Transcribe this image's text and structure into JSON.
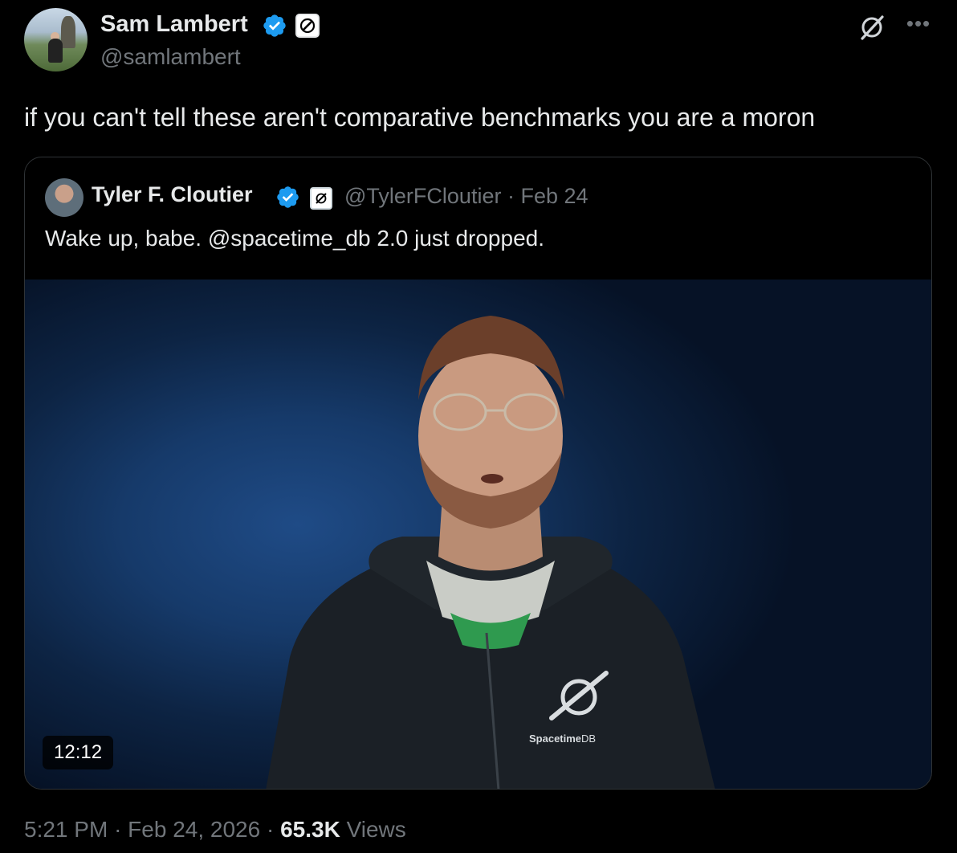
{
  "author": {
    "name": "Sam Lambert",
    "handle": "@samlambert"
  },
  "tweet": {
    "text": "if you can't tell these aren't comparative benchmarks you are a moron"
  },
  "quoted": {
    "author_name": "Tyler F. Cloutier",
    "handle": "@TylerFCloutier",
    "separator": "·",
    "date": "Feb 24",
    "text": "Wake up, babe. @spacetime_db 2.0 just dropped.",
    "video": {
      "duration": "12:12",
      "logo_text_bold": "Spacetime",
      "logo_text_light": "DB"
    }
  },
  "footer": {
    "time": "5:21 PM",
    "sep1": "·",
    "date": "Feb 24, 2026",
    "sep2": "·",
    "views_count": "65.3K",
    "views_label": "Views"
  },
  "icons": {
    "verified": "verified-badge-icon",
    "affiliate": "affiliate-badge-icon",
    "grok": "grok-icon",
    "more": "more-options-icon"
  },
  "colors": {
    "background": "#000000",
    "text_primary": "#e7e9ea",
    "text_secondary": "#71767b",
    "verified_blue": "#1d9bf0",
    "border": "#2f3336"
  }
}
